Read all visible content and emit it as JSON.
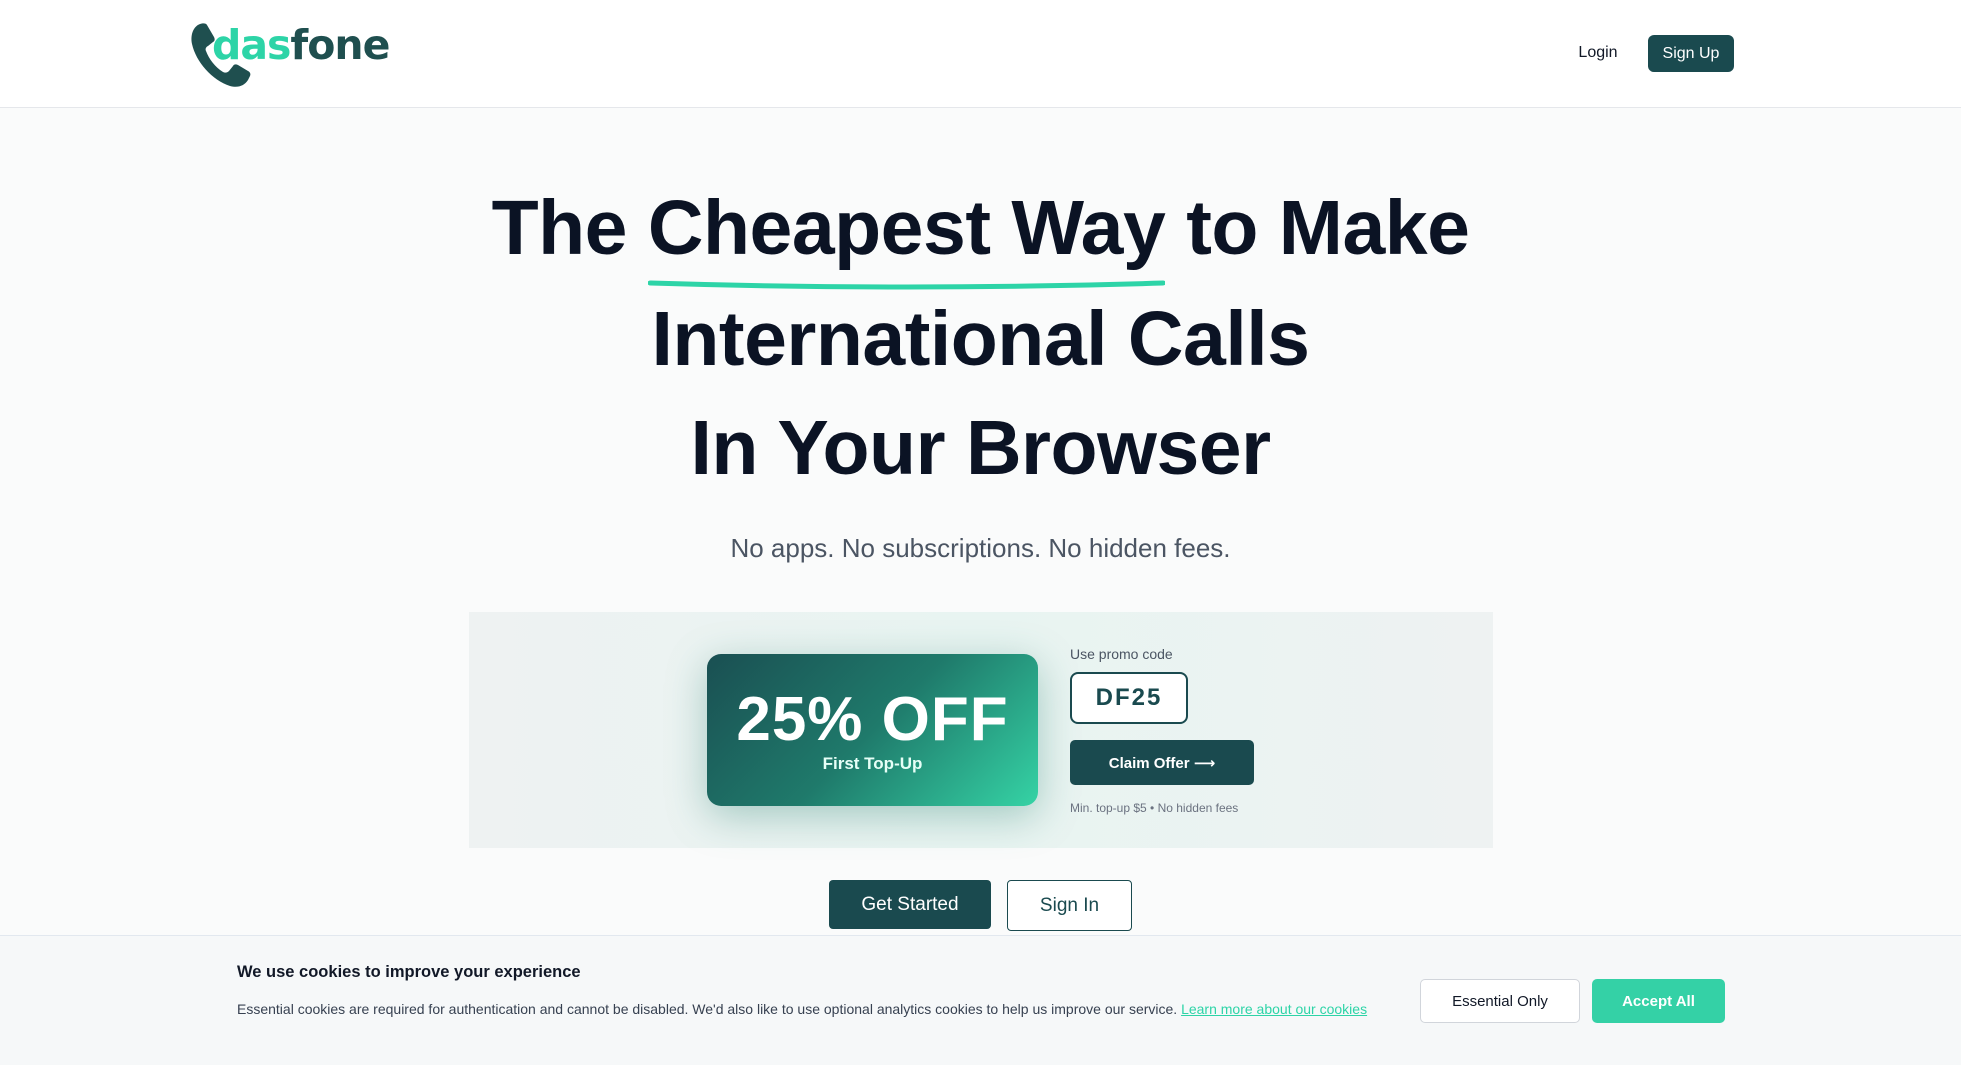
{
  "header": {
    "logo_das": "das",
    "logo_fone": "fone",
    "login_label": "Login",
    "signup_label": "Sign Up"
  },
  "hero": {
    "line1_pre": "The ",
    "line1_highlight": "Cheapest Way",
    "line1_post": " to Make",
    "line2": "International Calls",
    "line3": "In Your Browser",
    "subtitle": "No apps. No subscriptions. No hidden fees."
  },
  "promo": {
    "discount": "25% OFF",
    "discount_sub": "First Top-Up",
    "code_label": "Use promo code",
    "code": "DF25",
    "claim_label": "Claim Offer ⟶",
    "note": "Min. top-up $5 • No hidden fees"
  },
  "cta": {
    "get_started": "Get Started",
    "sign_in": "Sign In"
  },
  "cookie": {
    "title": "We use cookies to improve your experience",
    "text": "Essential cookies are required for authentication and cannot be disabled. We'd also like to use optional analytics cookies to help us improve our service. ",
    "link": "Learn more about our cookies",
    "essential_label": "Essential Only",
    "accept_label": "Accept All"
  },
  "colors": {
    "brand_dark": "#1a4a4f",
    "brand_accent": "#2dd4a7"
  },
  "icons": {
    "logo": "phone-handset-icon"
  }
}
